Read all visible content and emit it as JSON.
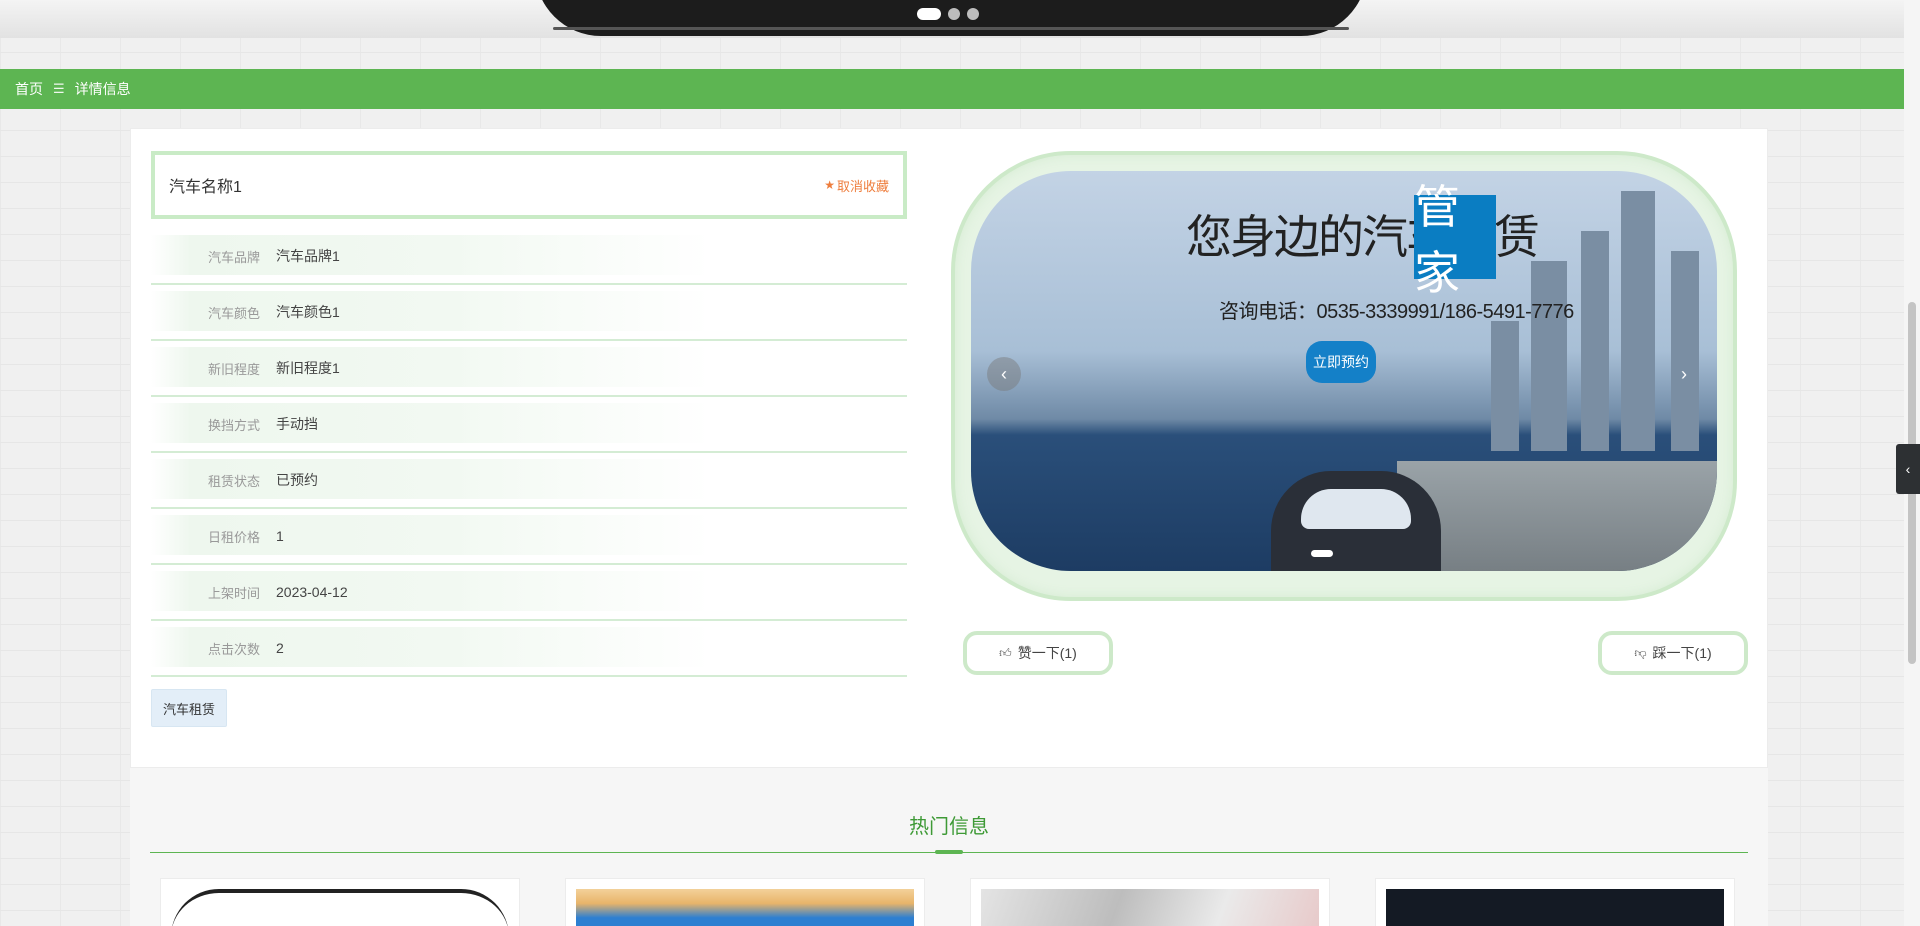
{
  "breadcrumb": {
    "home": "首页",
    "separator": "☰",
    "current": "详情信息"
  },
  "detail": {
    "title": "汽车名称1",
    "favorite_label": "取消收藏",
    "fields": [
      {
        "label": "汽车品牌",
        "value": "汽车品牌1"
      },
      {
        "label": "汽车颜色",
        "value": "汽车颜色1"
      },
      {
        "label": "新旧程度",
        "value": "新旧程度1"
      },
      {
        "label": "换挡方式",
        "value": "手动挡"
      },
      {
        "label": "租赁状态",
        "value": "已预约"
      },
      {
        "label": "日租价格",
        "value": "1"
      },
      {
        "label": "上架时间",
        "value": "2023-04-12"
      },
      {
        "label": "点击次数",
        "value": "2"
      }
    ],
    "tag": "汽车租赁"
  },
  "carousel": {
    "slogan": "您身边的汽车租赁",
    "slogan_highlight": "管家",
    "phone": "咨询电话：0535-3339991/186-5491-7776",
    "cta": "立即预约",
    "prev_icon": "chevron-left-icon",
    "next_icon": "chevron-right-icon"
  },
  "votes": {
    "up_label": "赞一下(1)",
    "down_label": "踩一下(1)"
  },
  "hot": {
    "title": "热门信息"
  },
  "colors": {
    "primary_green": "#5db552",
    "accent_orange": "#ee7d3c",
    "frame_green": "#cde9c9",
    "cta_blue": "#1480c8"
  }
}
